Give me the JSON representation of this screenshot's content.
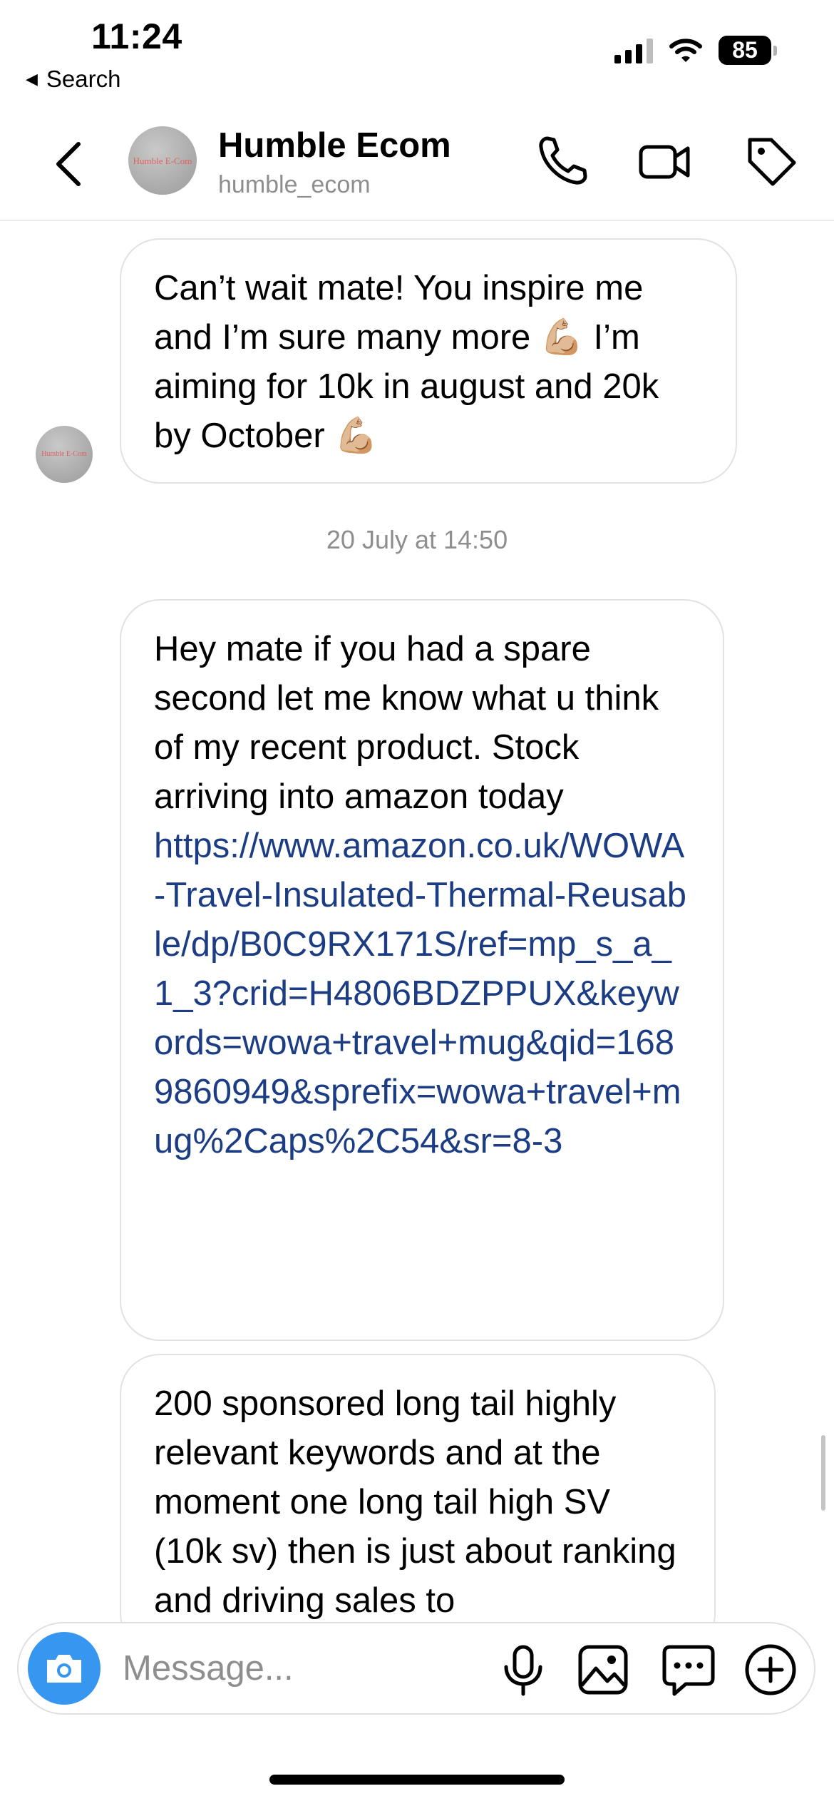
{
  "status_bar": {
    "time": "11:24",
    "back_label": "Search",
    "battery": "85",
    "icons": [
      "cellular-signal-icon",
      "wifi-icon",
      "battery-icon"
    ]
  },
  "header": {
    "name": "Humble Ecom",
    "handle": "humble_ecom",
    "avatar_text": "Humble E-Com",
    "icons": [
      "back-chevron-icon",
      "phone-icon",
      "video-camera-icon",
      "tag-icon"
    ]
  },
  "messages": [
    {
      "text": "Can’t wait mate! You inspire me and I’m sure many more 💪🏼 I’m aiming for 10k in august and 20k by October 💪🏼"
    },
    {
      "text": "Hey mate if you had a spare second let me know what u think of my recent product. Stock arriving into amazon today",
      "link": "https://www.amazon.co.uk/WOWA-Travel-Insulated-Thermal-Reusable/dp/B0C9RX171S/ref=mp_s_a_1_3?crid=H4806BDZPPUX&keywords=wowa+travel+mug&qid=1689860949&sprefix=wowa+travel+mug%2Caps%2C54&sr=8-3"
    },
    {
      "text": "200 sponsored long tail highly relevant keywords and at the moment one long tail high SV (10k sv) then is just about ranking and driving sales to"
    }
  ],
  "timestamp": "20 July at 14:50",
  "composer": {
    "placeholder": "Message...",
    "icons": [
      "camera-icon",
      "microphone-icon",
      "image-icon",
      "sticker-chat-icon",
      "plus-circle-icon"
    ]
  },
  "colors": {
    "accent_blue": "#3797f0",
    "link": "#1c3d84",
    "muted_text": "#8e8e8e",
    "bubble_border": "#e2e2e2"
  }
}
